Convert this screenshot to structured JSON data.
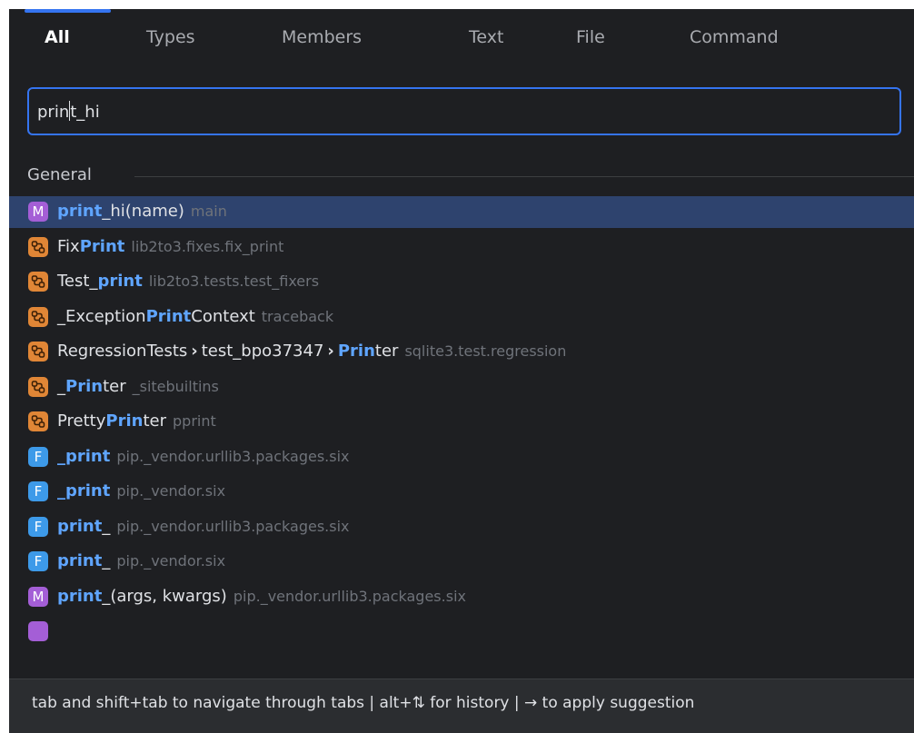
{
  "tabs": [
    {
      "label": "All",
      "active": true
    },
    {
      "label": "Types",
      "active": false
    },
    {
      "label": "Members",
      "active": false
    },
    {
      "label": "Text",
      "active": false
    },
    {
      "label": "File",
      "active": false
    },
    {
      "label": "Command",
      "active": false
    }
  ],
  "search": {
    "before_caret": "prin",
    "after_caret": "t_hi"
  },
  "section": {
    "label": "General"
  },
  "results": [
    {
      "icon": "method-icon",
      "badge": "M",
      "parts": [
        {
          "t": "print",
          "hl": true
        },
        {
          "t": "_hi(name)",
          "hl": false
        }
      ],
      "location": "main",
      "selected": true
    },
    {
      "icon": "class-icon",
      "badge": "",
      "parts": [
        {
          "t": "Fix",
          "hl": false
        },
        {
          "t": "Print",
          "hl": true
        }
      ],
      "location": "lib2to3.fixes.fix_print"
    },
    {
      "icon": "class-icon",
      "badge": "",
      "parts": [
        {
          "t": "Test_",
          "hl": false
        },
        {
          "t": "print",
          "hl": true
        }
      ],
      "location": "lib2to3.tests.test_fixers"
    },
    {
      "icon": "class-icon",
      "badge": "",
      "parts": [
        {
          "t": "_Exception",
          "hl": false
        },
        {
          "t": "Print",
          "hl": true
        },
        {
          "t": "Context",
          "hl": false
        }
      ],
      "location": "traceback"
    },
    {
      "icon": "class-icon",
      "badge": "",
      "parts": [
        {
          "t": "RegressionTests",
          "hl": false
        },
        {
          "t": "›",
          "sep": true
        },
        {
          "t": "test_bpo37347",
          "hl": false
        },
        {
          "t": "›",
          "sep": true
        },
        {
          "t": "Prin",
          "hl": true
        },
        {
          "t": "ter",
          "hl": false
        }
      ],
      "location": "sqlite3.test.regression"
    },
    {
      "icon": "class-icon",
      "badge": "",
      "parts": [
        {
          "t": "_",
          "hl": false
        },
        {
          "t": "Prin",
          "hl": true
        },
        {
          "t": "ter",
          "hl": false
        }
      ],
      "location": "_sitebuiltins"
    },
    {
      "icon": "class-icon",
      "badge": "",
      "parts": [
        {
          "t": "Pretty",
          "hl": false
        },
        {
          "t": "Prin",
          "hl": true
        },
        {
          "t": "ter",
          "hl": false
        }
      ],
      "location": "pprint"
    },
    {
      "icon": "function-icon",
      "badge": "F",
      "parts": [
        {
          "t": "_print",
          "hl": true
        }
      ],
      "location": "pip._vendor.urllib3.packages.six"
    },
    {
      "icon": "function-icon",
      "badge": "F",
      "parts": [
        {
          "t": "_print",
          "hl": true
        }
      ],
      "location": "pip._vendor.six"
    },
    {
      "icon": "function-icon",
      "badge": "F",
      "parts": [
        {
          "t": "print",
          "hl": true
        },
        {
          "t": "_",
          "hl": false
        }
      ],
      "location": "pip._vendor.urllib3.packages.six"
    },
    {
      "icon": "function-icon",
      "badge": "F",
      "parts": [
        {
          "t": "print",
          "hl": true
        },
        {
          "t": "_",
          "hl": false
        }
      ],
      "location": "pip._vendor.six"
    },
    {
      "icon": "method-icon",
      "badge": "M",
      "parts": [
        {
          "t": "print",
          "hl": true
        },
        {
          "t": "_(args, kwargs)",
          "hl": false
        }
      ],
      "location": "pip._vendor.urllib3.packages.six"
    }
  ],
  "footer": {
    "hint": "tab and shift+tab to navigate through tabs  |  alt+⇅ for history  |  → to apply suggestion"
  },
  "colors": {
    "accent": "#3574f0",
    "highlight": "#5fa5ff",
    "method": "#a45ed6",
    "class": "#e08636",
    "function": "#3d9ae9"
  }
}
